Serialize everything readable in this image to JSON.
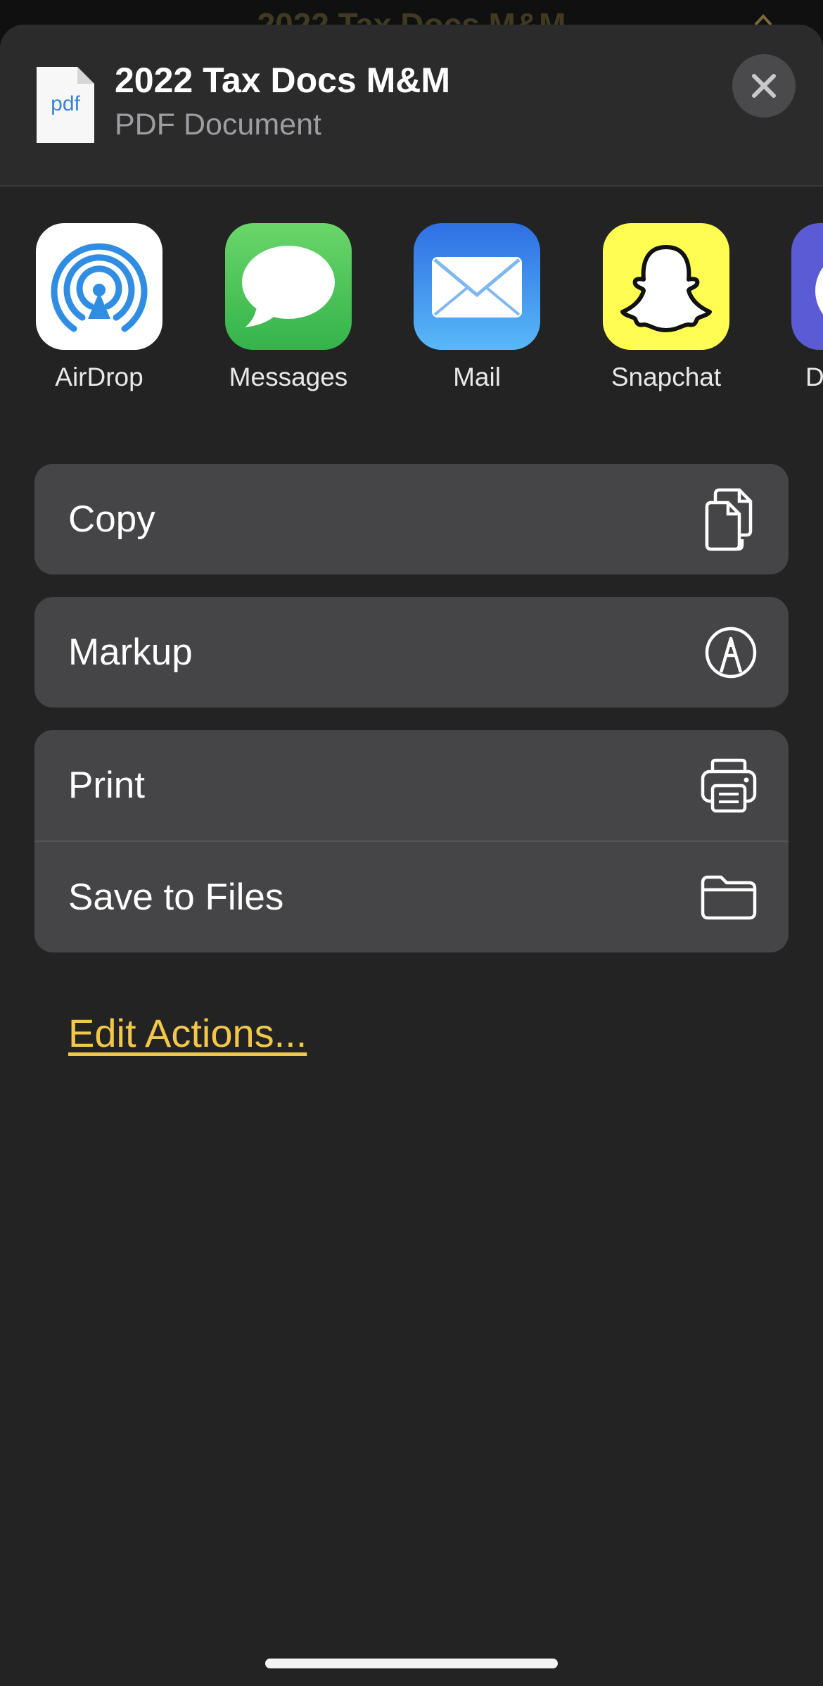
{
  "background": {
    "title": "2022 Tax Docs M&M"
  },
  "header": {
    "file_icon_label": "pdf",
    "title": "2022 Tax Docs M&M",
    "subtitle": "PDF Document"
  },
  "apps": [
    {
      "label": "AirDrop",
      "icon": "airdrop-icon"
    },
    {
      "label": "Messages",
      "icon": "messages-icon"
    },
    {
      "label": "Mail",
      "icon": "mail-icon"
    },
    {
      "label": "Snapchat",
      "icon": "snapchat-icon"
    },
    {
      "label": "D",
      "icon": "partial-app-icon"
    }
  ],
  "actions": {
    "copy": "Copy",
    "markup": "Markup",
    "print": "Print",
    "save_to_files": "Save to Files"
  },
  "edit_actions": "Edit Actions...",
  "colors": {
    "accent": "#f2c74a",
    "sheet": "#232323",
    "row": "#454547"
  }
}
